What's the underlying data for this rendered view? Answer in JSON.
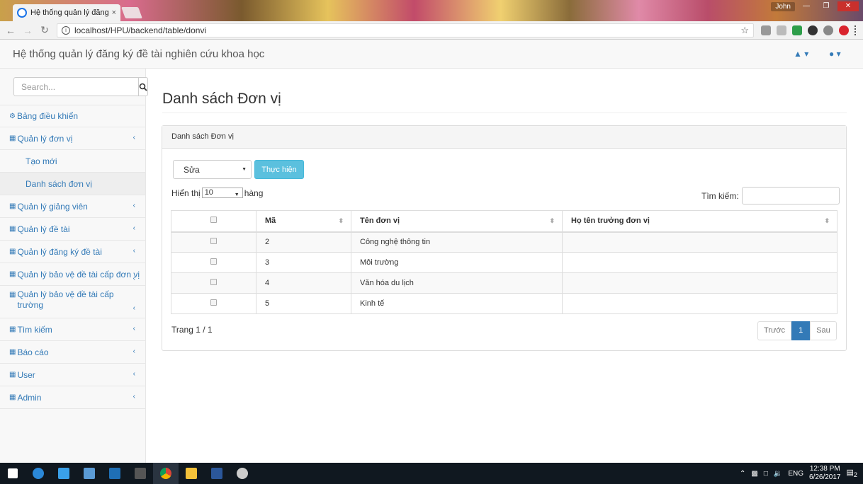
{
  "browser": {
    "tab_title": "Hệ thống quản lý đăng k",
    "tab_close": "×",
    "url": "localhost/HPU/backend/table/donvi",
    "window_user": "John"
  },
  "header": {
    "title": "Hệ thống quản lý đăng ký đề tài nghiên cứu khoa học"
  },
  "sidebar": {
    "search_placeholder": "Search...",
    "items": [
      {
        "label": "Bảng điều khiển",
        "icon": "dashboard-icon"
      },
      {
        "label": "Quản lý đơn vị",
        "icon": "sitemap-icon"
      },
      {
        "label": "Quản lý giảng viên",
        "icon": "sitemap-icon"
      },
      {
        "label": "Quản lý đề tài",
        "icon": "sitemap-icon"
      },
      {
        "label": "Quản lý đăng ký đề tài",
        "icon": "sitemap-icon"
      },
      {
        "label": "Quản lý bảo vệ đề tài cấp đơn vị",
        "icon": "sitemap-icon"
      },
      {
        "label": "Quản lý bảo vệ đề tài cấp trường",
        "icon": "sitemap-icon"
      },
      {
        "label": "Tìm kiếm",
        "icon": "sitemap-icon"
      },
      {
        "label": "Báo cáo",
        "icon": "sitemap-icon"
      },
      {
        "label": "User",
        "icon": "sitemap-icon"
      },
      {
        "label": "Admin",
        "icon": "sitemap-icon"
      }
    ],
    "subitems": [
      {
        "label": "Tạo mới"
      },
      {
        "label": "Danh sách đơn vị"
      }
    ]
  },
  "main": {
    "page_title": "Danh sách Đơn vị",
    "panel_title": "Danh sách Đơn vị",
    "action_select": "Sửa",
    "action_button": "Thực hiện",
    "length_prefix": "Hiển thị",
    "length_value": "10",
    "length_suffix": "hàng",
    "search_label": "Tìm kiếm:",
    "columns": [
      "Mã",
      "Tên đơn vị",
      "Họ tên trưởng đơn vị"
    ],
    "rows": [
      {
        "ma": "2",
        "ten": "Công nghệ thông tin",
        "truong": ""
      },
      {
        "ma": "3",
        "ten": "Môi trường",
        "truong": ""
      },
      {
        "ma": "4",
        "ten": "Văn hóa du lịch",
        "truong": ""
      },
      {
        "ma": "5",
        "ten": "Kinh tế",
        "truong": ""
      }
    ],
    "page_info": "Trang 1 / 1",
    "pager": {
      "prev": "Trước",
      "current": "1",
      "next": "Sau"
    }
  },
  "taskbar": {
    "tray_lang": "ENG",
    "time": "12:38 PM",
    "date": "6/26/2017",
    "notif_count": "2"
  },
  "colors": {
    "link": "#337ab7",
    "info_button": "#5bc0de",
    "taskbar": "#101820"
  }
}
